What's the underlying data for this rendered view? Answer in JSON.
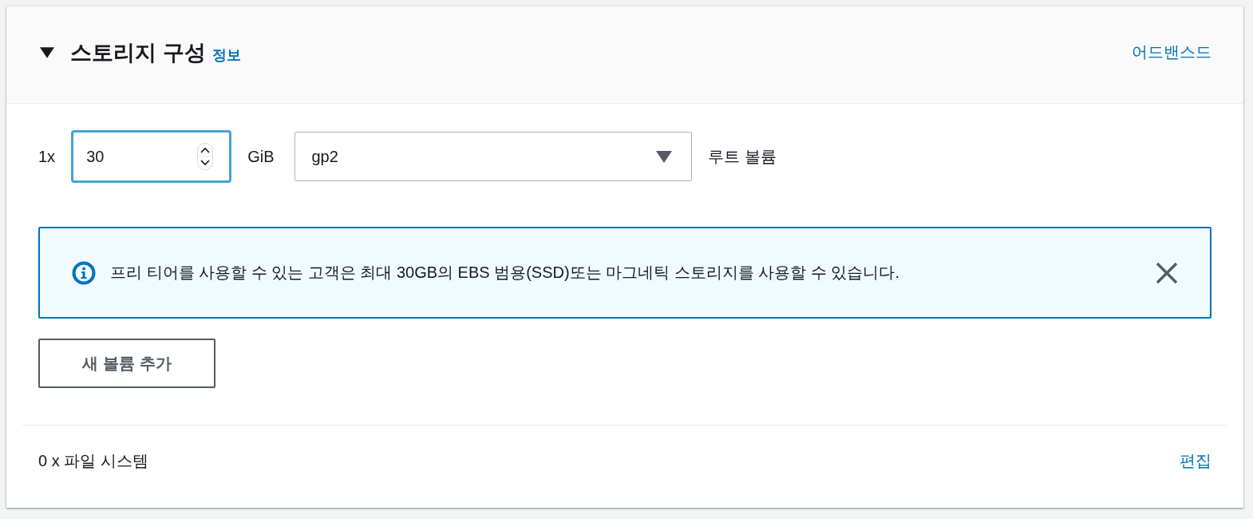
{
  "section": {
    "title": "스토리지 구성",
    "expanded": true,
    "info_link": "정보",
    "advanced_link": "어드밴스드"
  },
  "volume": {
    "count": "1x",
    "size": "30",
    "focused": true,
    "unit": "GiB",
    "type": "gp2",
    "label": "루트 볼륨"
  },
  "alert": {
    "kind": "info",
    "message": "프리 티어를 사용할 수 있는 고객은 최대 30GB의 EBS 범용(SSD)또는 마그네틱 스토리지를 사용할 수 있습니다.",
    "dismissible": true
  },
  "add_volume_button": "새 볼륨 추가",
  "file_systems": {
    "summary": "0 x 파일 시스템",
    "edit_link": "편집"
  }
}
